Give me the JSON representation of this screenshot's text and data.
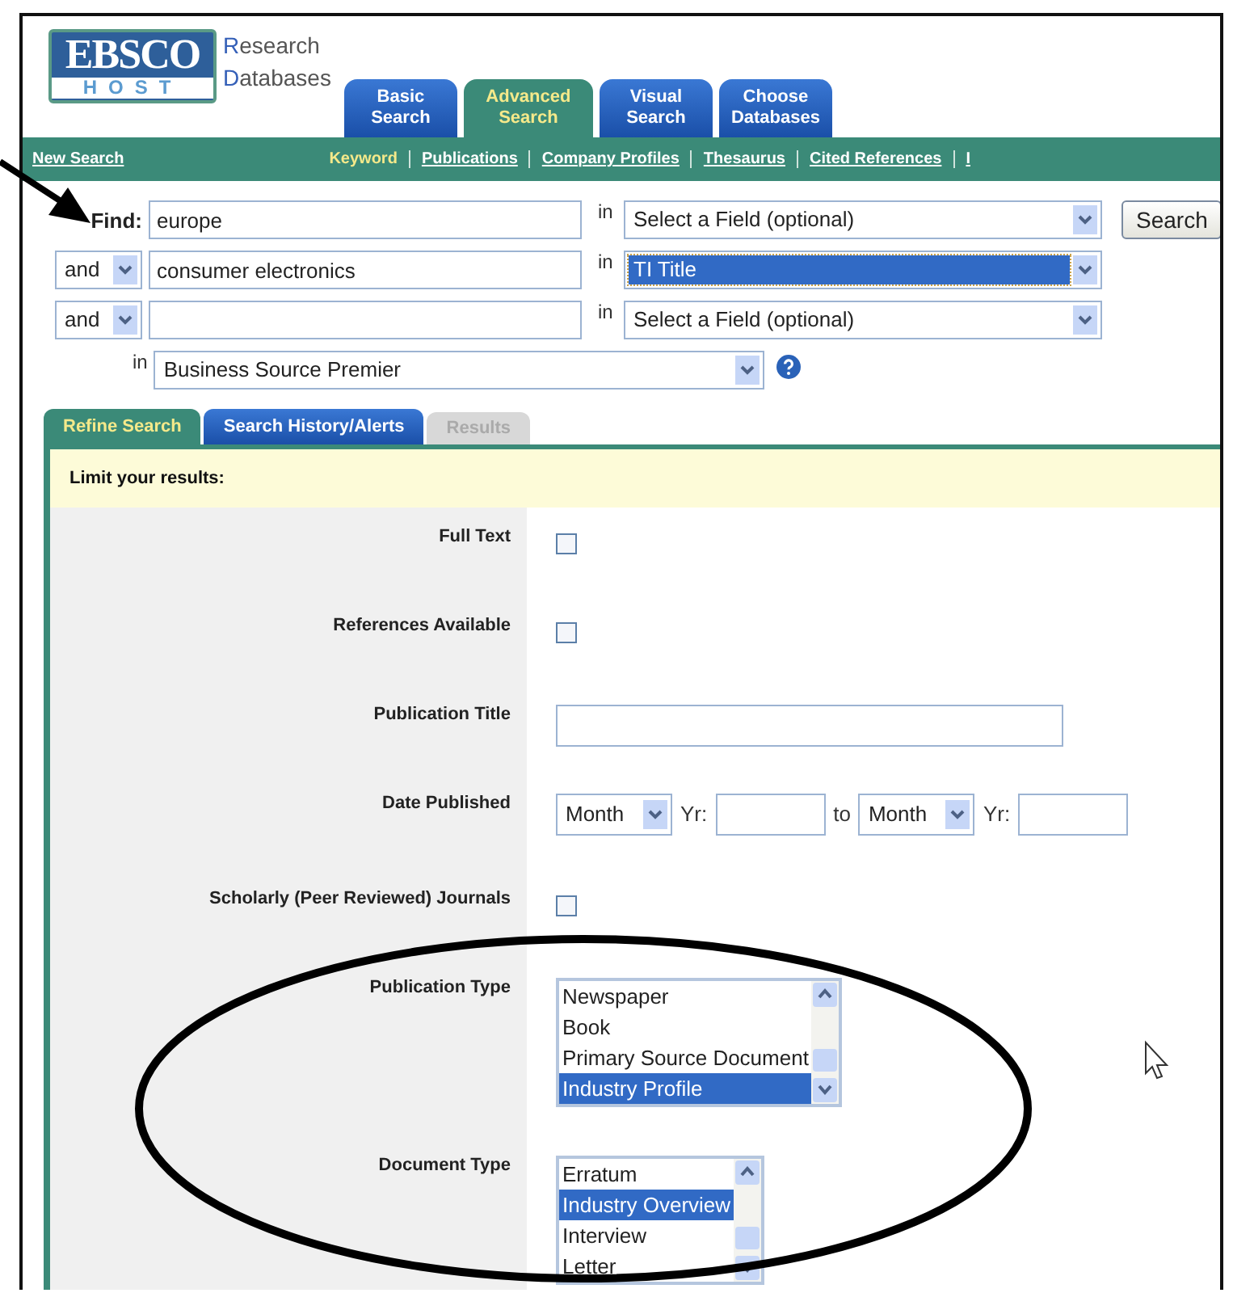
{
  "logo": {
    "brand": "EBSCO",
    "sub": "HOST",
    "tagline": [
      "Research",
      "Databases"
    ]
  },
  "tabs": [
    {
      "label": "Basic Search",
      "selected": false
    },
    {
      "label": "Advanced Search",
      "selected": true
    },
    {
      "label": "Visual Search",
      "selected": false
    },
    {
      "label": "Choose Databases",
      "selected": false
    }
  ],
  "nav": {
    "new_search": "New Search",
    "links": [
      {
        "label": "Keyword",
        "selected": true
      },
      {
        "label": "Publications",
        "selected": false
      },
      {
        "label": "Company Profiles",
        "selected": false
      },
      {
        "label": "Thesaurus",
        "selected": false
      },
      {
        "label": "Cited References",
        "selected": false
      },
      {
        "label": "I",
        "selected": false
      }
    ]
  },
  "search_rows": [
    {
      "label": "Find:",
      "value": "europe",
      "in": "in",
      "field": "Select a Field (optional)",
      "highlighted": false
    },
    {
      "operator": "and",
      "value": "consumer electronics",
      "in": "in",
      "field": "TI Title",
      "highlighted": true
    },
    {
      "operator": "and",
      "value": "",
      "in": "in",
      "field": "Select a Field (optional)",
      "highlighted": false
    }
  ],
  "search_button": "Search",
  "database": {
    "in": "in",
    "value": "Business Source Premier"
  },
  "result_tabs": [
    {
      "label": "Refine Search",
      "selected": true,
      "disabled": false
    },
    {
      "label": "Search History/Alerts",
      "selected": false,
      "disabled": false
    },
    {
      "label": "Results",
      "selected": false,
      "disabled": true
    }
  ],
  "limits": {
    "heading": "Limit your results:",
    "rows": [
      {
        "kind": "checkbox",
        "label": "Full Text",
        "checked": false
      },
      {
        "kind": "checkbox",
        "label": "References Available",
        "checked": false
      },
      {
        "kind": "text",
        "label": "Publication Title",
        "value": ""
      },
      {
        "kind": "date",
        "label": "Date Published",
        "from_month": "Month",
        "from_yr": "Yr:",
        "to": "to",
        "to_month": "Month",
        "to_yr": "Yr:"
      },
      {
        "kind": "checkbox",
        "label": "Scholarly (Peer Reviewed) Journals",
        "checked": false
      },
      {
        "kind": "list",
        "label": "Publication Type",
        "options": [
          {
            "label": "Newspaper",
            "selected": false
          },
          {
            "label": "Book",
            "selected": false
          },
          {
            "label": "Primary Source Document",
            "selected": false
          },
          {
            "label": "Industry Profile",
            "selected": true
          }
        ]
      },
      {
        "kind": "list",
        "label": "Document Type",
        "options": [
          {
            "label": "Erratum",
            "selected": false
          },
          {
            "label": "Industry Overview",
            "selected": true
          },
          {
            "label": "Interview",
            "selected": false
          },
          {
            "label": "Letter",
            "selected": false
          }
        ]
      }
    ]
  }
}
